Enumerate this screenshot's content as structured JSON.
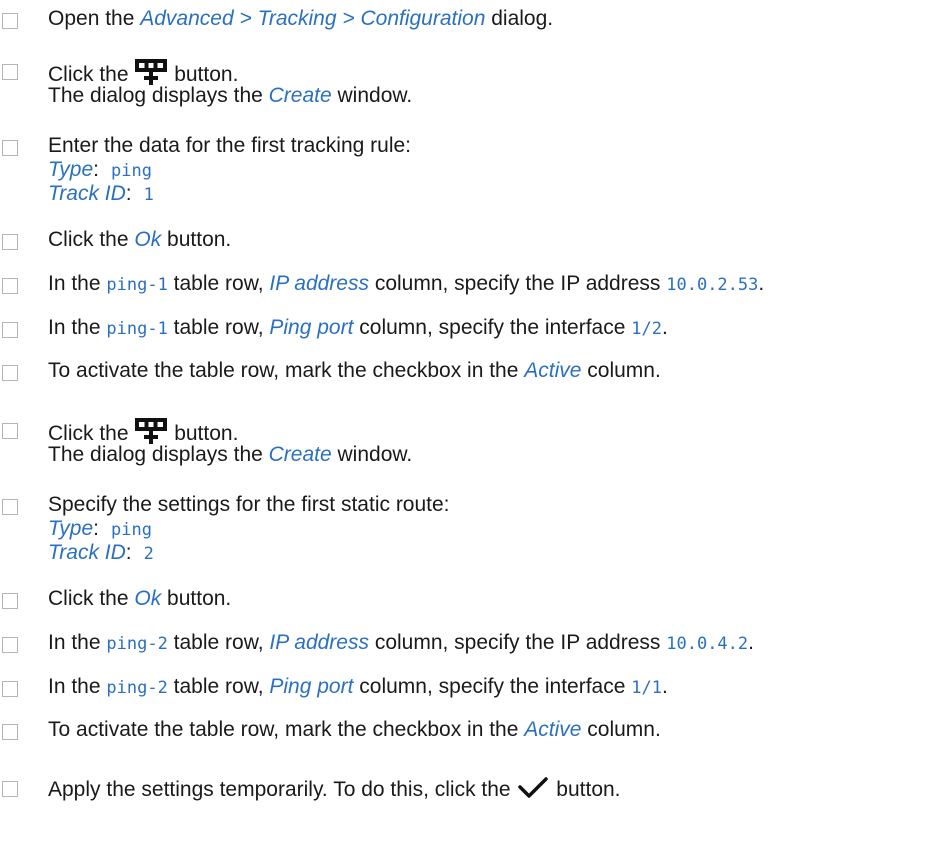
{
  "steps": [
    {
      "t1": "Open the ",
      "ui": "Advanced > Tracking > Configuration",
      "t2": " dialog."
    },
    {
      "t1": "Click the ",
      "t2": " button.",
      "icon": "add-table-row-icon",
      "sub_t1": "The dialog displays the ",
      "sub_ui": "Create",
      "sub_t2": " window."
    },
    {
      "t1": "Enter the data for the first tracking rule:",
      "f1_label": "Type",
      "f1_sep": ":",
      "f1_value": "ping",
      "f2_label": "Track ID",
      "f2_sep": ":",
      "f2_value": "1"
    },
    {
      "t1": "Click the ",
      "ui": "Ok",
      "t2": " button."
    },
    {
      "t1": "In the ",
      "code1": "ping-1",
      "t2": " table row, ",
      "ui": "IP address",
      "t3": " column, specify the IP address ",
      "code2": "10.0.2.53",
      "t4": "."
    },
    {
      "t1": "In the ",
      "code1": "ping-1",
      "t2": " table row, ",
      "ui": "Ping port",
      "t3": " column, specify the interface ",
      "code2": "1/2",
      "t4": "."
    },
    {
      "t1": "To activate the table row, mark the checkbox in the ",
      "ui": "Active",
      "t2": " column."
    },
    {
      "t1": "Click the ",
      "t2": " button.",
      "icon": "add-table-row-icon",
      "sub_t1": "The dialog displays the ",
      "sub_ui": "Create",
      "sub_t2": " window."
    },
    {
      "t1": "Specify the settings for the first static route:",
      "f1_label": "Type",
      "f1_sep": ":",
      "f1_value": "ping",
      "f2_label": "Track ID",
      "f2_sep": ":",
      "f2_value": "2"
    },
    {
      "t1": "Click the ",
      "ui": "Ok",
      "t2": " button."
    },
    {
      "t1": "In the ",
      "code1": "ping-2",
      "t2": " table row, ",
      "ui": "IP address",
      "t3": " column, specify the IP address ",
      "code2": "10.0.4.2",
      "t4": "."
    },
    {
      "t1": "In the ",
      "code1": "ping-2",
      "t2": " table row, ",
      "ui": "Ping port",
      "t3": " column, specify the interface ",
      "code2": "1/1",
      "t4": "."
    },
    {
      "t1": "To activate the table row, mark the checkbox in the ",
      "ui": "Active",
      "t2": " column."
    },
    {
      "t1": "Apply the settings temporarily. To do this, click the ",
      "t2": " button.",
      "icon": "checkmark-icon"
    }
  ],
  "colors": {
    "link": "#2a70c2",
    "text": "#1a1a1a",
    "checkbox_border": "#b4b4b4"
  }
}
